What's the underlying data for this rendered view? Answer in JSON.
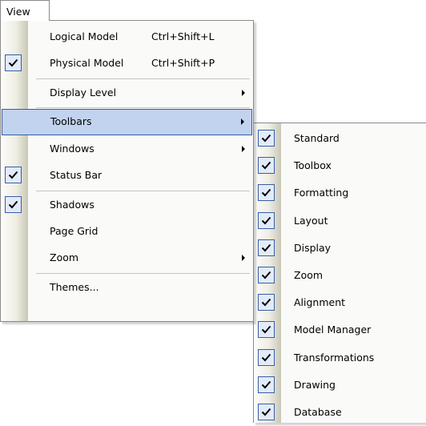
{
  "menubar": {
    "view_label": "View"
  },
  "view_menu": {
    "logical_model": {
      "label": "Logical Model",
      "shortcut": "Ctrl+Shift+L",
      "checked": false
    },
    "physical_model": {
      "label": "Physical Model",
      "shortcut": "Ctrl+Shift+P",
      "checked": true
    },
    "display_level": {
      "label": "Display Level",
      "submenu": true
    },
    "toolbars": {
      "label": "Toolbars",
      "submenu": true,
      "highlighted": true
    },
    "windows": {
      "label": "Windows",
      "submenu": true
    },
    "status_bar": {
      "label": "Status Bar",
      "checked": true
    },
    "shadows": {
      "label": "Shadows",
      "checked": true
    },
    "page_grid": {
      "label": "Page Grid",
      "checked": false
    },
    "zoom": {
      "label": "Zoom",
      "submenu": true
    },
    "themes": {
      "label": "Themes..."
    }
  },
  "toolbars_submenu": {
    "items": [
      {
        "label": "Standard",
        "checked": true
      },
      {
        "label": "Toolbox",
        "checked": true
      },
      {
        "label": "Formatting",
        "checked": true
      },
      {
        "label": "Layout",
        "checked": true
      },
      {
        "label": "Display",
        "checked": true
      },
      {
        "label": "Zoom",
        "checked": true
      },
      {
        "label": "Alignment",
        "checked": true
      },
      {
        "label": "Model Manager",
        "checked": true
      },
      {
        "label": "Transformations",
        "checked": true
      },
      {
        "label": "Drawing",
        "checked": true
      },
      {
        "label": "Database",
        "checked": true
      }
    ]
  },
  "colors": {
    "highlight_bg": "#c2d3ef",
    "highlight_border": "#355fa7",
    "check_bg": "#e3ebf8"
  }
}
